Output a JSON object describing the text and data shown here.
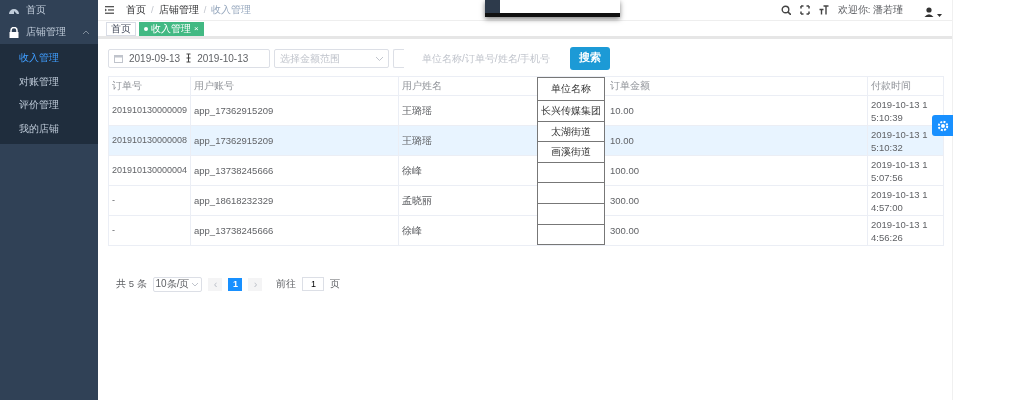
{
  "sidebar": {
    "items": [
      {
        "label": "首页"
      },
      {
        "label": "店铺管理",
        "expanded": true,
        "children": [
          {
            "label": "收入管理",
            "selected": true
          },
          {
            "label": "对账管理",
            "selected": false
          },
          {
            "label": "评价管理",
            "selected": false
          },
          {
            "label": "我的店铺",
            "selected": false
          }
        ]
      }
    ]
  },
  "header": {
    "breadcrumb": [
      "首页",
      "店铺管理",
      "收入管理"
    ],
    "separator": "/",
    "welcome": "欢迎你: 潘若瑾"
  },
  "tags": [
    {
      "label": "首页",
      "selected": false
    },
    {
      "label": "收入管理",
      "selected": true,
      "close": "×"
    }
  ],
  "filters": {
    "date_start": "2019-09-13",
    "date_end": "2019-10-13",
    "amount_placeholder": "选择金额范围",
    "search_placeholder": "单位名称/订单号/姓名/手机号",
    "search_button": "搜索"
  },
  "table": {
    "columns": [
      "订单号",
      "用户账号",
      "用户姓名",
      "订单金额",
      "付款时间"
    ],
    "rows": [
      {
        "selected": false,
        "cells": [
          "201910130000009",
          "app_17362915209",
          "王璐瑶",
          "10.00",
          "2019-10-13 15:10:39"
        ]
      },
      {
        "selected": true,
        "cells": [
          "201910130000008",
          "app_17362915209",
          "王璐瑶",
          "10.00",
          "2019-10-13 15:10:32"
        ]
      },
      {
        "selected": false,
        "cells": [
          "201910130000004",
          "app_13738245666",
          "徐峰",
          "100.00",
          "2019-10-13 15:07:56"
        ]
      },
      {
        "selected": false,
        "cells": [
          "-",
          "app_18618232329",
          "孟晓丽",
          "300.00",
          "2019-10-13 14:57:00"
        ]
      },
      {
        "selected": false,
        "cells": [
          "-",
          "app_13738245666",
          "徐峰",
          "300.00",
          "2019-10-13 14:56:26"
        ]
      }
    ]
  },
  "unit_dropdown": {
    "header": "单位名称",
    "items": [
      "长兴传媒集团",
      "太湖街道",
      "画溪街道"
    ]
  },
  "pagination": {
    "total": "共 5 条",
    "page_size": "10条/页",
    "prev": "‹",
    "pages": [
      {
        "label": "1",
        "selected": true
      }
    ],
    "next": "›",
    "goto": "前往",
    "goto_value": "1",
    "page_suffix": "页"
  }
}
